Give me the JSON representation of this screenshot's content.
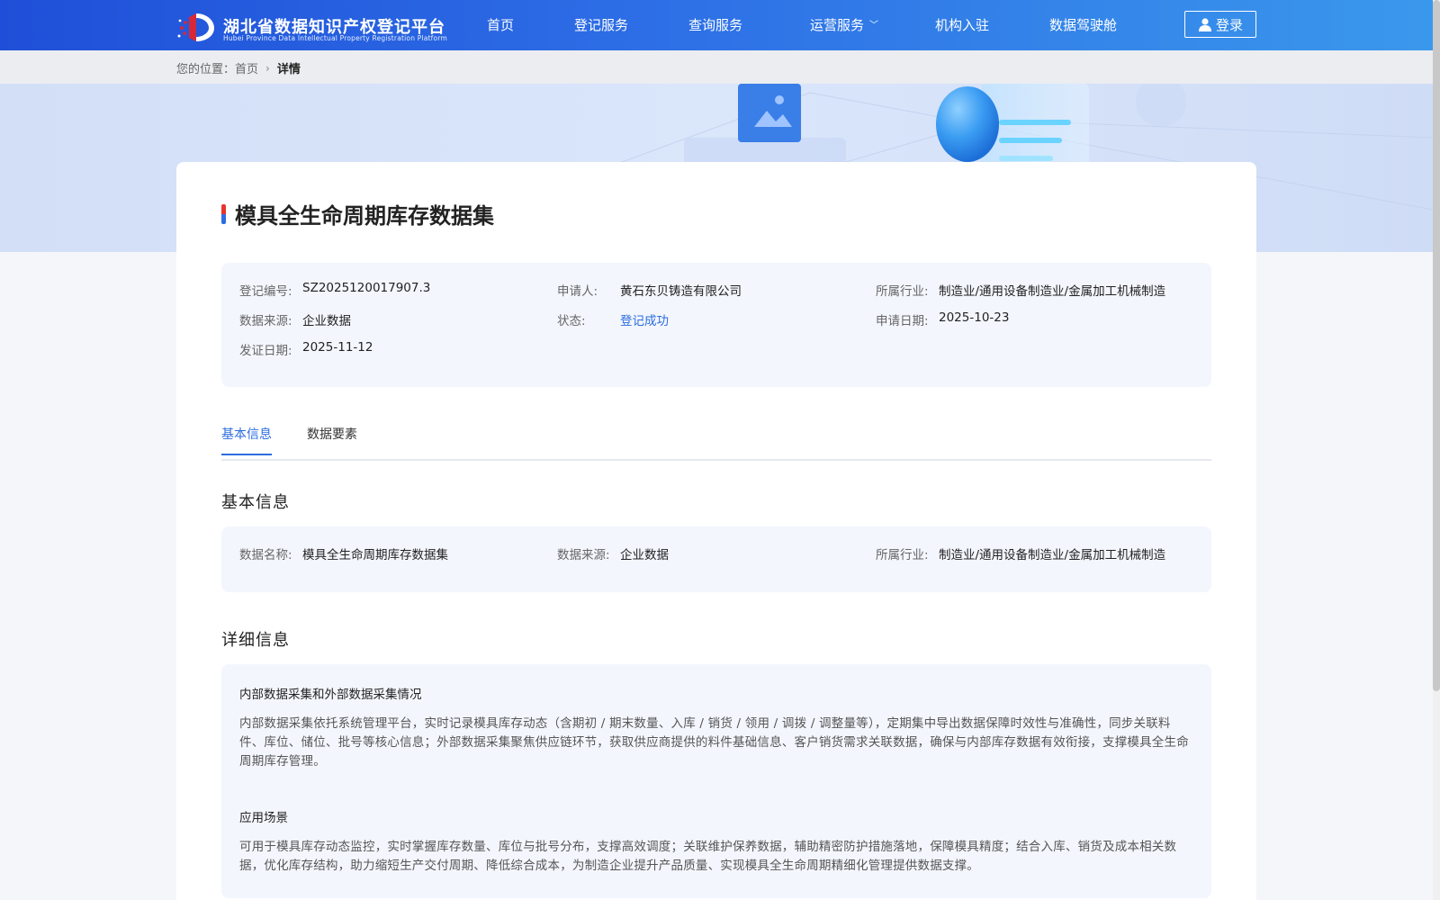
{
  "header": {
    "logo": {
      "title": "湖北省数据知识产权登记平台",
      "subtitle": "Hubei Province Data Intellectual Property Registration Platform"
    },
    "nav": [
      {
        "label": "首页"
      },
      {
        "label": "登记服务"
      },
      {
        "label": "查询服务"
      },
      {
        "label": "运营服务",
        "has_dropdown": true
      },
      {
        "label": "机构入驻"
      },
      {
        "label": "数据驾驶舱"
      }
    ],
    "login_label": "登录",
    "login_icon": "user-icon"
  },
  "breadcrumb": {
    "prefix": "您的位置：",
    "home": "首页",
    "current": "详情",
    "separator_icon": "chevron-right-icon"
  },
  "detail": {
    "title": "模具全生命周期库存数据集",
    "summary": {
      "reg_no_label": "登记编号:",
      "reg_no": "SZ2025120017907.3",
      "applicant_label": "申请人:",
      "applicant": "黄石东贝铸造有限公司",
      "industry_label": "所属行业:",
      "industry": "制造业/通用设备制造业/金属加工机械制造",
      "source_label": "数据来源:",
      "source": "企业数据",
      "status_label": "状态:",
      "status": "登记成功",
      "status_color": "#2c6de0",
      "apply_date_label": "申请日期:",
      "apply_date": "2025-10-23",
      "cert_date_label": "发证日期:",
      "cert_date": "2025-11-12"
    },
    "tabs": [
      {
        "label": "基本信息",
        "active": true
      },
      {
        "label": "数据要素",
        "active": false
      }
    ],
    "basic_section": {
      "heading": "基本信息",
      "name_label": "数据名称:",
      "name": "模具全生命周期库存数据集",
      "source_label": "数据来源:",
      "source": "企业数据",
      "industry_label": "所属行业:",
      "industry": "制造业/通用设备制造业/金属加工机械制造"
    },
    "detail_section": {
      "heading": "详细信息",
      "collection_heading": "内部数据采集和外部数据采集情况",
      "collection_text": "内部数据采集依托系统管理平台，实时记录模具库存动态（含期初 / 期末数量、入库 / 销货 / 领用 / 调拨 / 调整量等），定期集中导出数据保障时效性与准确性，同步关联料件、库位、储位、批号等核心信息；外部数据采集聚焦供应链环节，获取供应商提供的料件基础信息、客户销货需求关联数据，确保与内部库存数据有效衔接，支撑模具全生命周期库存管理。",
      "scenario_heading": "应用场景",
      "scenario_text": "可用于模具库存动态监控，实时掌握库存数量、库位与批号分布，支撑高效调度；关联维护保养数据，辅助精密防护措施落地，保障模具精度；结合入库、销货及成本相关数据，优化库存结构，助力缩短生产交付周期、降低综合成本，为制造企业提升产品质量、实现模具全生命周期精细化管理提供数据支撑。"
    }
  },
  "colors": {
    "header_start": "#1f4fd8",
    "header_end": "#3a98ec",
    "accent": "#2c6de0",
    "title_mark_red": "#e8332f"
  }
}
